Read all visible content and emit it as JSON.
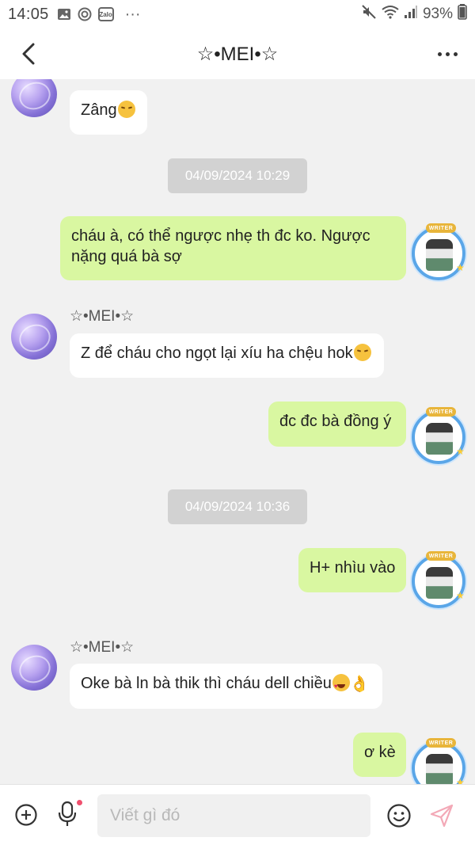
{
  "status_bar": {
    "time": "14:05",
    "battery": "93%",
    "app_icons": [
      "gallery-icon",
      "messenger-icon",
      "zalo-icon"
    ],
    "zalo_label": "Zalo",
    "more": "···"
  },
  "header": {
    "title": "☆•MEI•☆"
  },
  "conversation": {
    "timestamps": [
      "04/09/2024 10:29",
      "04/09/2024 10:36"
    ],
    "messages": [
      {
        "side": "in",
        "text": "Zâng",
        "emoji": "pensive"
      },
      {
        "side": "out",
        "text_line1": "cháu à, có thể ngược nhẹ th đc ko. Ngược",
        "text_line2": "nặng quá bà sợ"
      },
      {
        "side": "in",
        "sender": "☆•MEI•☆",
        "text": "Z để cháu cho ngọt lại xíu ha chệu hok",
        "emoji": "pensive"
      },
      {
        "side": "out",
        "text": "đc đc bà đồng ý"
      },
      {
        "side": "out",
        "text": "H+ nhìu vào"
      },
      {
        "side": "in",
        "sender": "☆•MEI•☆",
        "text": "Oke bà ln bà thik thì cháu dell chiều",
        "emoji": "heart-eyes + ok-hand"
      },
      {
        "side": "out",
        "text": "ơ kè"
      }
    ],
    "avatar_badge": "WRITER"
  },
  "composer": {
    "placeholder": "Viết gì đó"
  },
  "colors": {
    "outgoing_bubble": "#d9f7a1",
    "incoming_bubble": "#ffffff",
    "background": "#f1f1f1",
    "timestamp_pill": "#d2d2d2"
  }
}
